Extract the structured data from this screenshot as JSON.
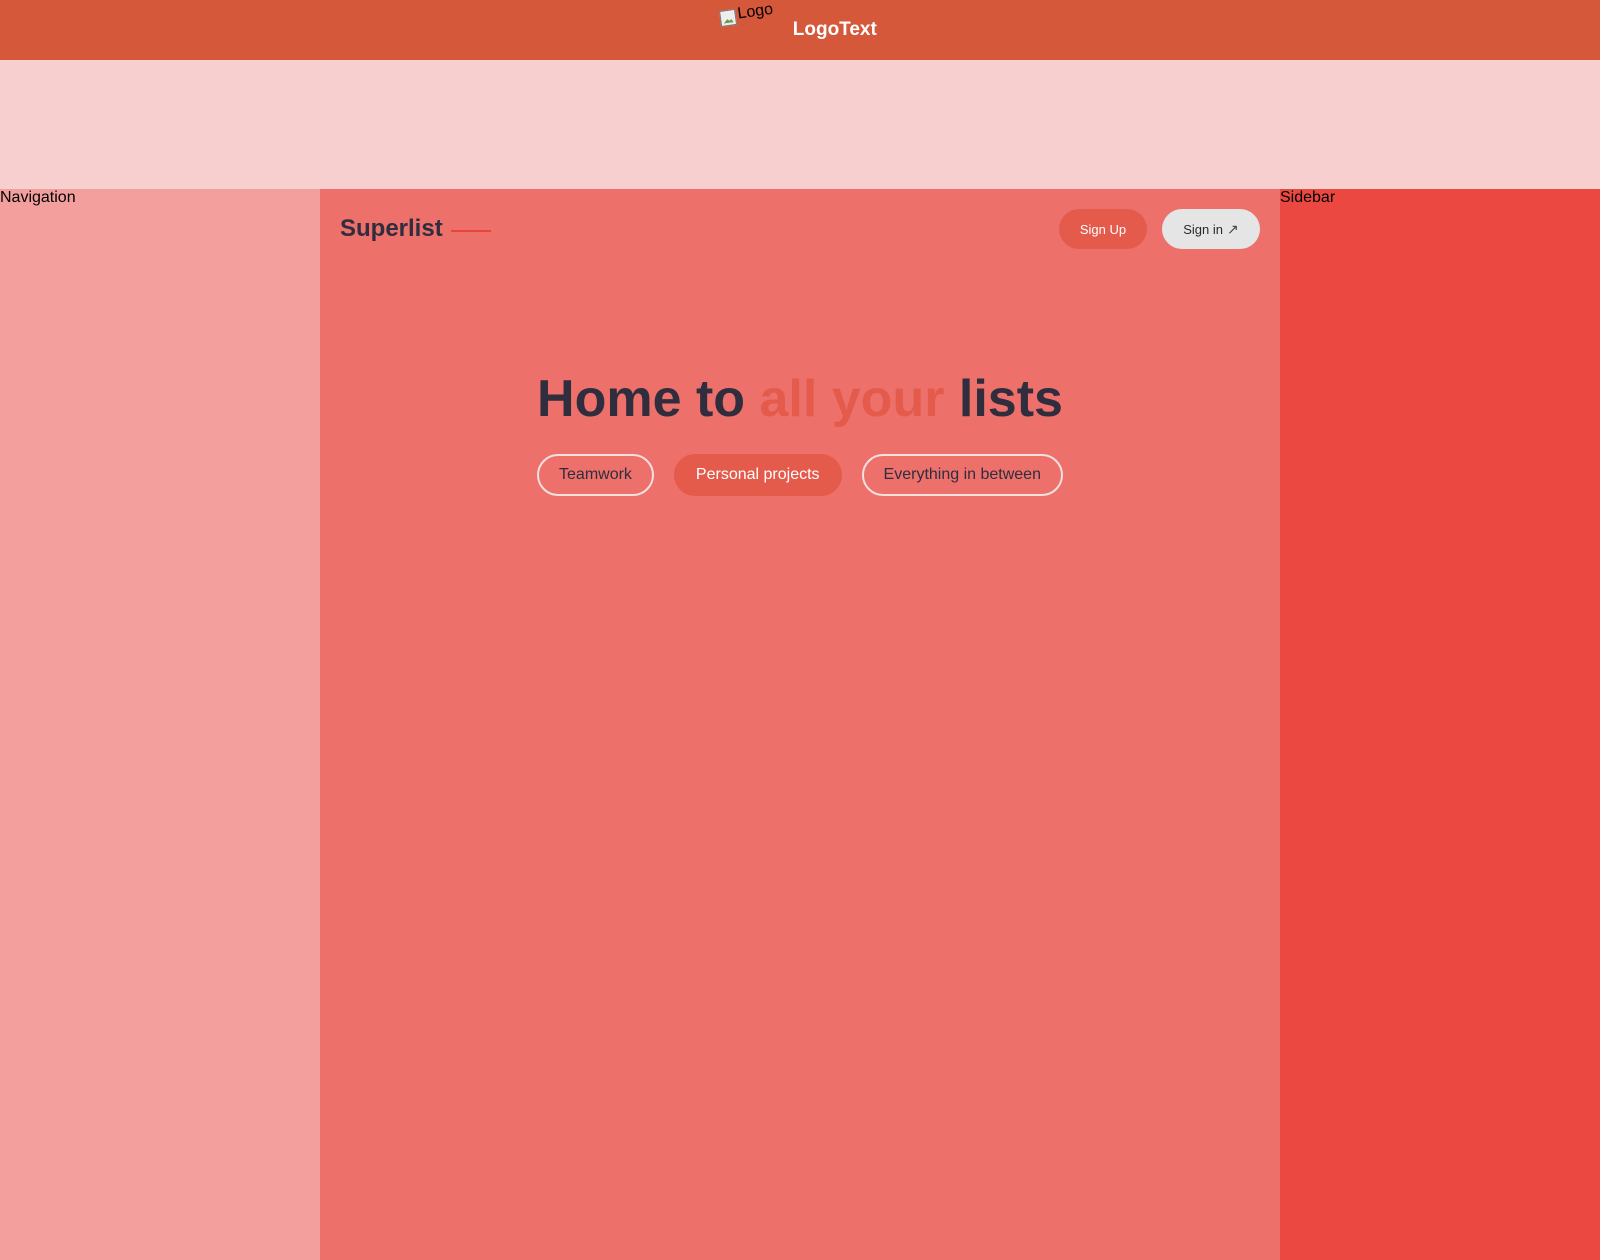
{
  "topbar": {
    "logo_alt": "Logo",
    "logo_text": "LogoText"
  },
  "navigation": {
    "label": "Navigation"
  },
  "sidebar": {
    "label": "Sidebar"
  },
  "main": {
    "brand": "Superlist",
    "signup_label": "Sign Up",
    "signin_label": "Sign in",
    "signin_icon": "↗",
    "hero": {
      "part1": "Home to ",
      "accent": "all your",
      "part2": " lists"
    },
    "pills": [
      {
        "label": "Teamwork",
        "active": false
      },
      {
        "label": "Personal projects",
        "active": true
      },
      {
        "label": "Everything in between",
        "active": false
      }
    ]
  },
  "colors": {
    "topbar": "#d5583a",
    "banner": "#f7cfcf",
    "navigation": "#f29f9e",
    "main": "#ed706b",
    "sidebar": "#ea4841",
    "accent": "#e45b4b",
    "text_dark": "#2f2d3e"
  }
}
